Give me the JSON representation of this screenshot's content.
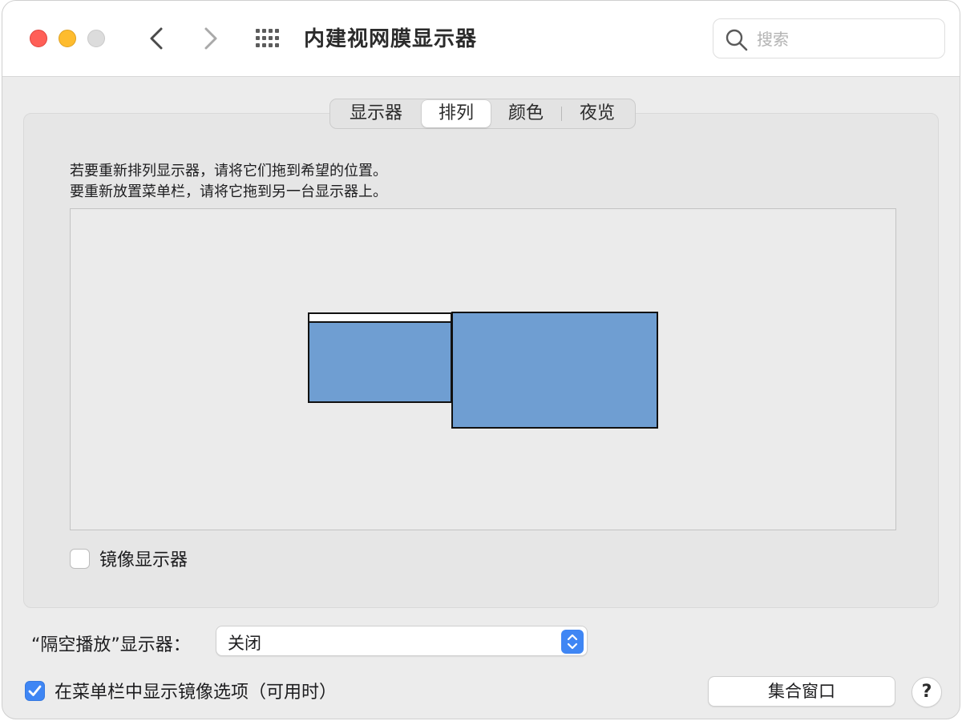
{
  "window": {
    "title": "内建视网膜显示器",
    "controls": {
      "close_color": "#ff5f57",
      "minimize_color": "#febc2e",
      "zoom_color": "#dcdcdc"
    },
    "nav": {
      "back_icon": "chevron-left-icon",
      "forward_icon": "chevron-right-icon",
      "grid_icon": "grid-icon"
    },
    "search": {
      "placeholder": "搜索",
      "value": ""
    }
  },
  "tabs": [
    {
      "label": "显示器",
      "selected": false
    },
    {
      "label": "排列",
      "selected": true
    },
    {
      "label": "颜色",
      "selected": false
    },
    {
      "label": "夜览",
      "selected": false
    }
  ],
  "arrangement": {
    "instruction_line1": "若要重新排列显示器，请将它们拖到希望的位置。",
    "instruction_line2": "要重新放置菜单栏，请将它拖到另一台显示器上。",
    "display_color": "#6f9ed2",
    "mirror_label": "镜像显示器",
    "mirror_checked": false
  },
  "airplay": {
    "label": "“隔空播放”显示器：",
    "selected_value": "关闭"
  },
  "menu_bar_option": {
    "label": "在菜单栏中显示镜像选项（可用时）",
    "checked": true
  },
  "buttons": {
    "gather_windows": "集合窗口",
    "help": "?"
  },
  "accent_color": "#3f86f4"
}
